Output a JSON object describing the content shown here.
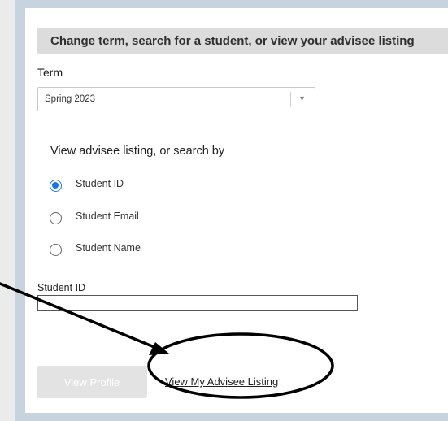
{
  "form": {
    "header": "Change term, search for a student, or view your advisee listing",
    "term": {
      "label": "Term",
      "selected": "Spring 2023"
    },
    "search_section": {
      "heading": "View advisee listing, or search by",
      "options": [
        {
          "label": "Student ID",
          "checked": true
        },
        {
          "label": "Student Email",
          "checked": false
        },
        {
          "label": "Student Name",
          "checked": false
        }
      ]
    },
    "student_id": {
      "label": "Student ID",
      "value": ""
    },
    "buttons": {
      "view_profile": "View Profile",
      "view_advisee_listing": "View My Advisee Listing"
    }
  },
  "colors": {
    "accent": "#1a73e8",
    "header_bar": "#dcdcdc",
    "frame": "#c7d3de",
    "annotation": "#000000"
  }
}
